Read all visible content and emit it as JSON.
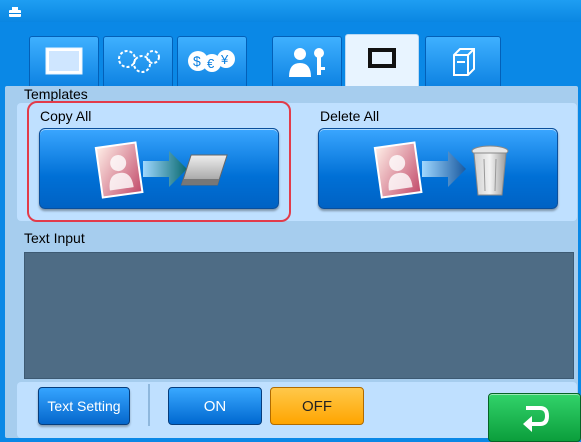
{
  "colors": {
    "accent_blue": "#0a88e6",
    "selection_red": "#e23b4a",
    "off_orange": "#ffa500",
    "return_green": "#18b44d"
  },
  "tabs": [
    {
      "icon": "screen-icon",
      "active": false
    },
    {
      "icon": "gears-icon",
      "active": false
    },
    {
      "icon": "currency-icon",
      "active": false
    },
    {
      "icon": "user-key-icon",
      "active": false
    },
    {
      "icon": "frame-icon",
      "active": true
    },
    {
      "icon": "drawer-icon",
      "active": false
    }
  ],
  "templates": {
    "section_label": "Templates",
    "copy_all_label": "Copy All",
    "delete_all_label": "Delete All"
  },
  "text_input": {
    "section_label": "Text Input",
    "value": ""
  },
  "footer": {
    "text_setting_label": "Text Setting",
    "on_label": "ON",
    "off_label": "OFF"
  }
}
